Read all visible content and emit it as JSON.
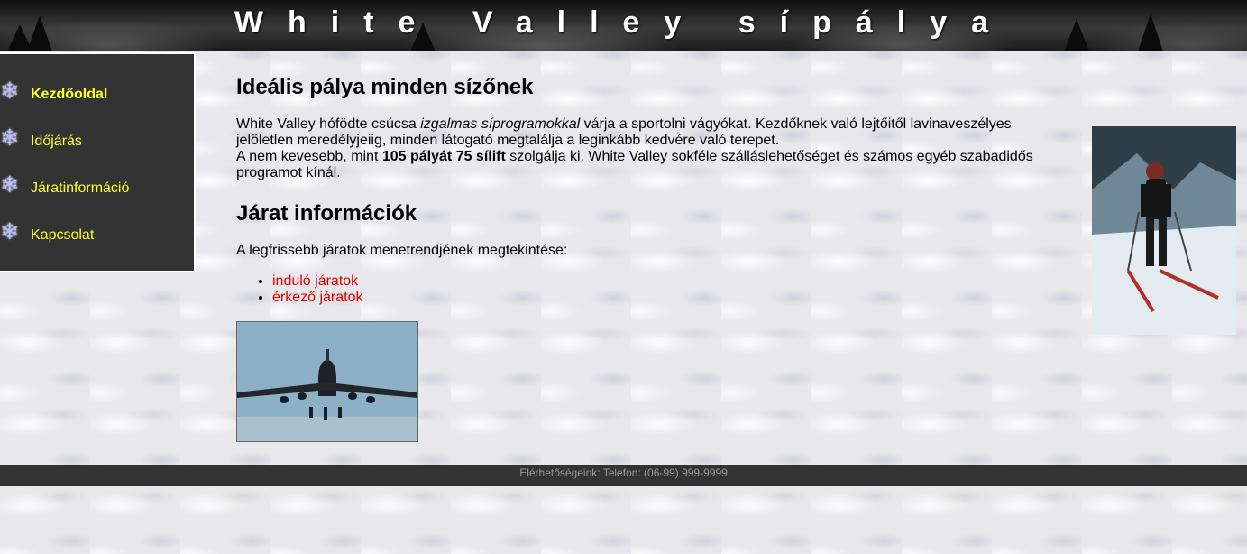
{
  "header": {
    "title": "White Valley sípálya"
  },
  "sidebar": {
    "items": [
      {
        "label": "Kezdőoldal",
        "active": true,
        "icon": "snowflake-icon"
      },
      {
        "label": "Időjárás",
        "active": false,
        "icon": "snowflake-icon"
      },
      {
        "label": "Járatinformáció",
        "active": false,
        "icon": "snowflake-icon"
      },
      {
        "label": "Kapcsolat",
        "active": false,
        "icon": "snowflake-icon"
      }
    ]
  },
  "main": {
    "intro_heading": "Ideális pálya minden sízőnek",
    "intro_p1_a": "White Valley hófödte csúcsa ",
    "intro_p1_em": "izgalmas síprogramokkal",
    "intro_p1_b": " várja a sportolni vágyókat. Kezdőknek való lejtőitől lavinaveszélyes jelöletlen meredélyjeiig, minden látogató megtalálja a leginkább kedvére való terepet.",
    "intro_p2_a": "A nem kevesebb, mint ",
    "intro_p2_strong": "105 pályát 75 sílift",
    "intro_p2_b": " szolgálja ki. White Valley sokféle szálláslehetőséget és számos egyéb szabadidős programot kínál.",
    "flights_heading": "Járat információk",
    "flights_text": "A legfrissebb járatok menetrendjének megtekintése:",
    "flight_links": [
      "induló járatok",
      "érkező járatok"
    ]
  },
  "footer": {
    "text": "Elérhetőségeink: Telefon: (06-99) 999-9999"
  },
  "colors": {
    "nav_text": "#ffff33",
    "nav_background": "#333333",
    "link": "#e60000",
    "footer_text": "#9a9a9a"
  }
}
